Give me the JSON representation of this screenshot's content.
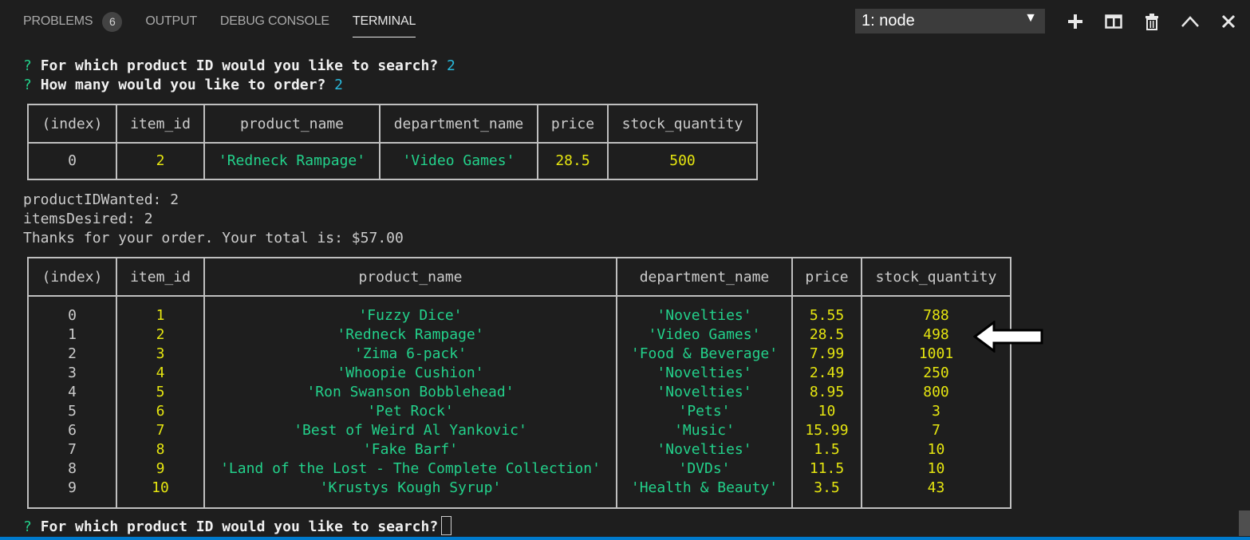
{
  "tabs": [
    {
      "label": "PROBLEMS",
      "badge": "6"
    },
    {
      "label": "OUTPUT"
    },
    {
      "label": "DEBUG CONSOLE"
    },
    {
      "label": "TERMINAL"
    }
  ],
  "terminal_select": {
    "value": "1: node"
  },
  "actions": [
    "plus-icon",
    "split-terminal-icon",
    "trash-icon",
    "chevron-up-icon",
    "close-icon"
  ],
  "prompts": {
    "search_mark": "?",
    "search_question": "For which product ID would you like to search?",
    "search_answer": "2",
    "order_mark": "?",
    "order_question": "How many would you like to order?",
    "order_answer": "2",
    "final_mark": "?",
    "final_question": "For which product ID would you like to search?"
  },
  "table1": {
    "headers": [
      "(index)",
      "item_id",
      "product_name",
      "department_name",
      "price",
      "stock_quantity"
    ],
    "rows": [
      [
        "0",
        "2",
        "'Redneck Rampage'",
        "'Video Games'",
        "28.5",
        "500"
      ]
    ]
  },
  "log": {
    "line1": "productIDWanted: 2",
    "line2": "itemsDesired: 2",
    "line3": "Thanks for your order. Your total is: $57.00"
  },
  "table2": {
    "headers": [
      "(index)",
      "item_id",
      "product_name",
      "department_name",
      "price",
      "stock_quantity"
    ],
    "rows": [
      [
        "0",
        "1",
        "'Fuzzy Dice'",
        "'Novelties'",
        "5.55",
        "788"
      ],
      [
        "1",
        "2",
        "'Redneck Rampage'",
        "'Video Games'",
        "28.5",
        "498"
      ],
      [
        "2",
        "3",
        "'Zima 6-pack'",
        "'Food & Beverage'",
        "7.99",
        "1001"
      ],
      [
        "3",
        "4",
        "'Whoopie Cushion'",
        "'Novelties'",
        "2.49",
        "250"
      ],
      [
        "4",
        "5",
        "'Ron Swanson Bobblehead'",
        "'Novelties'",
        "8.95",
        "800"
      ],
      [
        "5",
        "6",
        "'Pet Rock'",
        "'Pets'",
        "10",
        "3"
      ],
      [
        "6",
        "7",
        "'Best of Weird Al Yankovic'",
        "'Music'",
        "15.99",
        "7"
      ],
      [
        "7",
        "8",
        "'Fake Barf'",
        "'Novelties'",
        "1.5",
        "10"
      ],
      [
        "8",
        "9",
        "'Land of the Lost - The Complete Collection'",
        "'DVDs'",
        "11.5",
        "10"
      ],
      [
        "9",
        "10",
        "'Krustys Kough Syrup'",
        "'Health & Beauty'",
        "3.5",
        "43"
      ]
    ]
  }
}
